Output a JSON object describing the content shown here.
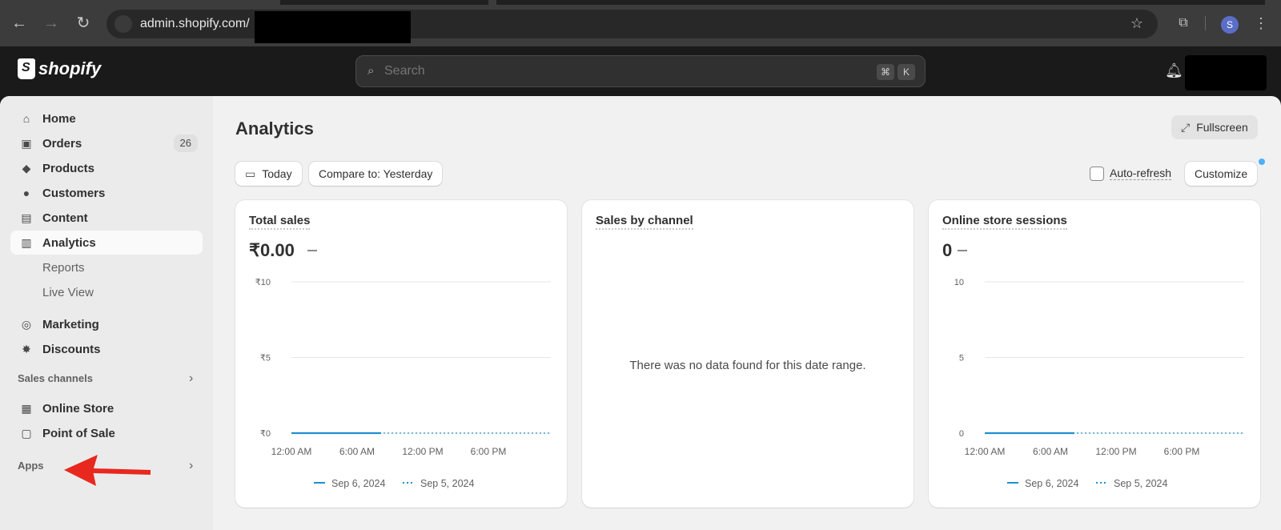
{
  "browser": {
    "url": "admin.shopify.com/",
    "profile_initial": "S"
  },
  "header": {
    "logo_text": "shopify",
    "search_placeholder": "Search",
    "shortcut_keys": [
      "⌘",
      "K"
    ]
  },
  "sidebar": {
    "items": [
      {
        "label": "Home",
        "icon": "home-icon"
      },
      {
        "label": "Orders",
        "icon": "orders-icon",
        "badge": "26"
      },
      {
        "label": "Products",
        "icon": "tag-icon"
      },
      {
        "label": "Customers",
        "icon": "person-icon"
      },
      {
        "label": "Content",
        "icon": "content-icon"
      },
      {
        "label": "Analytics",
        "icon": "analytics-icon",
        "active": true
      },
      {
        "label": "Reports",
        "sub": true
      },
      {
        "label": "Live View",
        "sub": true
      },
      {
        "label": "Marketing",
        "icon": "target-icon"
      },
      {
        "label": "Discounts",
        "icon": "discount-icon"
      }
    ],
    "sales_channels_heading": "Sales channels",
    "channels": [
      {
        "label": "Online Store",
        "icon": "store-icon"
      },
      {
        "label": "Point of Sale",
        "icon": "pos-icon"
      }
    ],
    "apps_heading": "Apps"
  },
  "main": {
    "title": "Analytics",
    "fullscreen_label": "Fullscreen",
    "today_label": "Today",
    "compare_label": "Compare to: Yesterday",
    "auto_refresh_label": "Auto-refresh",
    "customize_label": "Customize"
  },
  "cards": {
    "total_sales": {
      "title": "Total sales",
      "value": "₹0.00"
    },
    "sales_by_channel": {
      "title": "Sales by channel",
      "empty_message": "There was no data found for this date range."
    },
    "sessions": {
      "title": "Online store sessions",
      "value": "0"
    }
  },
  "colors": {
    "accent": "#1f8fd1",
    "annotation_arrow": "#e8281e"
  },
  "chart_data": [
    {
      "type": "line",
      "x": [
        "12:00 AM",
        "6:00 AM",
        "12:00 PM",
        "6:00 PM"
      ],
      "ylim": [
        0,
        10
      ],
      "yticks": [
        "₹0",
        "₹5",
        "₹10"
      ],
      "series": [
        {
          "name": "Sep 6, 2024",
          "style": "solid",
          "values": [
            0,
            0
          ]
        },
        {
          "name": "Sep 5, 2024",
          "style": "dotted",
          "values": [
            0,
            0,
            0,
            0
          ]
        }
      ],
      "grid": true,
      "legend": "bottom"
    },
    {
      "type": "line",
      "x": [
        "12:00 AM",
        "6:00 AM",
        "12:00 PM",
        "6:00 PM"
      ],
      "ylim": [
        0,
        10
      ],
      "yticks": [
        "0",
        "5",
        "10"
      ],
      "series": [
        {
          "name": "Sep 6, 2024",
          "style": "solid",
          "values": [
            0,
            0
          ]
        },
        {
          "name": "Sep 5, 2024",
          "style": "dotted",
          "values": [
            0,
            0,
            0,
            0
          ]
        }
      ],
      "grid": true,
      "legend": "bottom"
    }
  ]
}
